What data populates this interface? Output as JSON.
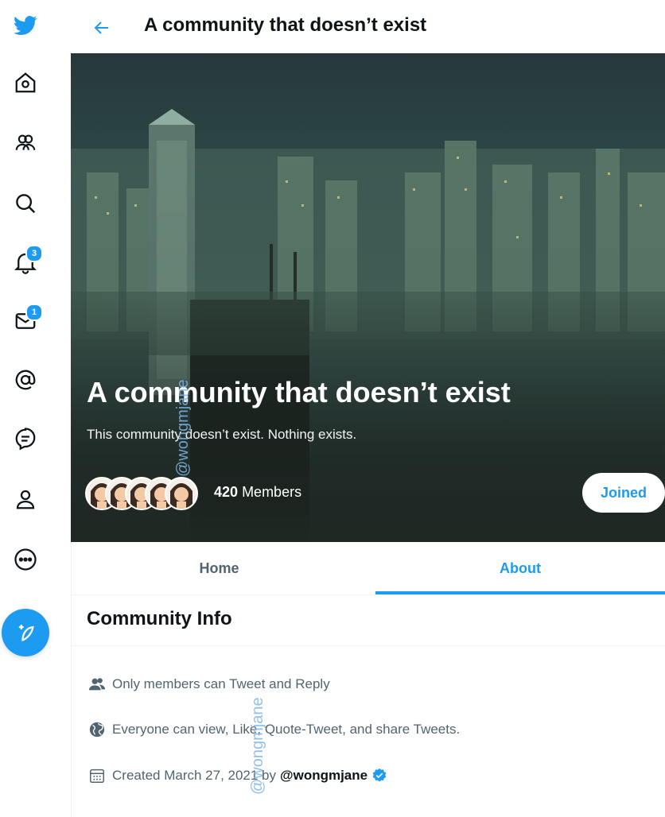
{
  "header": {
    "title": "A community that doesn’t exist"
  },
  "nav": {
    "items": [
      {
        "icon": "twitter-logo-icon"
      },
      {
        "icon": "home-icon"
      },
      {
        "icon": "communities-icon"
      },
      {
        "icon": "search-icon"
      },
      {
        "icon": "notifications-icon",
        "badge": "3"
      },
      {
        "icon": "messages-icon",
        "badge": "1"
      },
      {
        "icon": "mentions-icon"
      },
      {
        "icon": "topics-icon"
      },
      {
        "icon": "profile-icon"
      },
      {
        "icon": "more-icon"
      }
    ],
    "compose_icon": "compose-tweet-icon"
  },
  "hero": {
    "title": "A community that doesn’t exist",
    "description": "This community doesn’t exist. Nothing exists.",
    "member_count": "420",
    "members_label": "Members",
    "joined_label": "Joined"
  },
  "tabs": [
    {
      "label": "Home",
      "selected": false
    },
    {
      "label": "About",
      "selected": true
    }
  ],
  "community_info": {
    "title": "Community Info",
    "rules": [
      {
        "icon": "people-icon",
        "text": "Only members can Tweet and Reply"
      },
      {
        "icon": "globe-icon",
        "text": "Everyone can view, Like, Quote-Tweet, and share Tweets."
      }
    ],
    "created": {
      "icon": "calendar-icon",
      "text": "Created March 27, 2021 by",
      "handle": "@wongmjane"
    }
  },
  "watermark": "@wongmjane",
  "colors": {
    "accent": "#1d9bf0",
    "text_primary": "#0f1419",
    "text_secondary": "#536471"
  }
}
